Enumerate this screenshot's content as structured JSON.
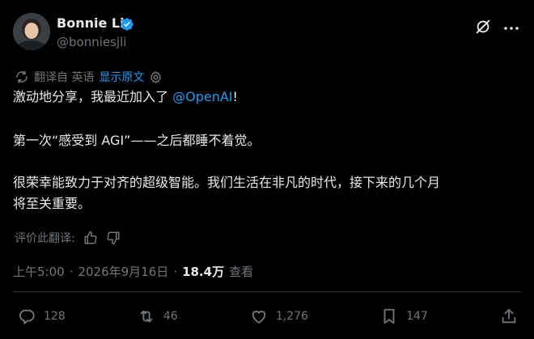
{
  "author": {
    "name": "Bonnie Li",
    "handle": "@bonniesjli"
  },
  "translation": {
    "label": "翻译自 英语",
    "show_original": "显示原文"
  },
  "tweet": {
    "line1_prefix": "激动地分享，我最近加入了 ",
    "mention": "@OpenAI",
    "line1_suffix": "!",
    "line2": "第一次“感受到 AGI”——之后都睡不着觉。",
    "line3": "很荣幸能致力于对齐的超级智能。我们生活在非凡的时代，接下来的几个月",
    "line4": "将至关重要。"
  },
  "rate_translation": {
    "label": "评价此翻译:"
  },
  "meta": {
    "time": "上午5:00",
    "sep1": "·",
    "date": "2026年9月16日",
    "sep2": "·",
    "views_count": "18.4万",
    "views_label": "查看"
  },
  "actions": {
    "replies": "128",
    "reposts": "46",
    "likes": "1,276",
    "bookmarks": "147"
  },
  "colors": {
    "background": "#000000",
    "text": "#e7e9ea",
    "muted": "#71767b",
    "accent": "#1d9bf0",
    "divider": "#2f3336"
  },
  "icons": [
    "verified-badge-icon",
    "grok-icon",
    "more-icon",
    "translate-icon",
    "settings-icon",
    "thumbs-up-icon",
    "thumbs-down-icon",
    "reply-icon",
    "repost-icon",
    "like-icon",
    "bookmark-icon",
    "share-icon"
  ]
}
